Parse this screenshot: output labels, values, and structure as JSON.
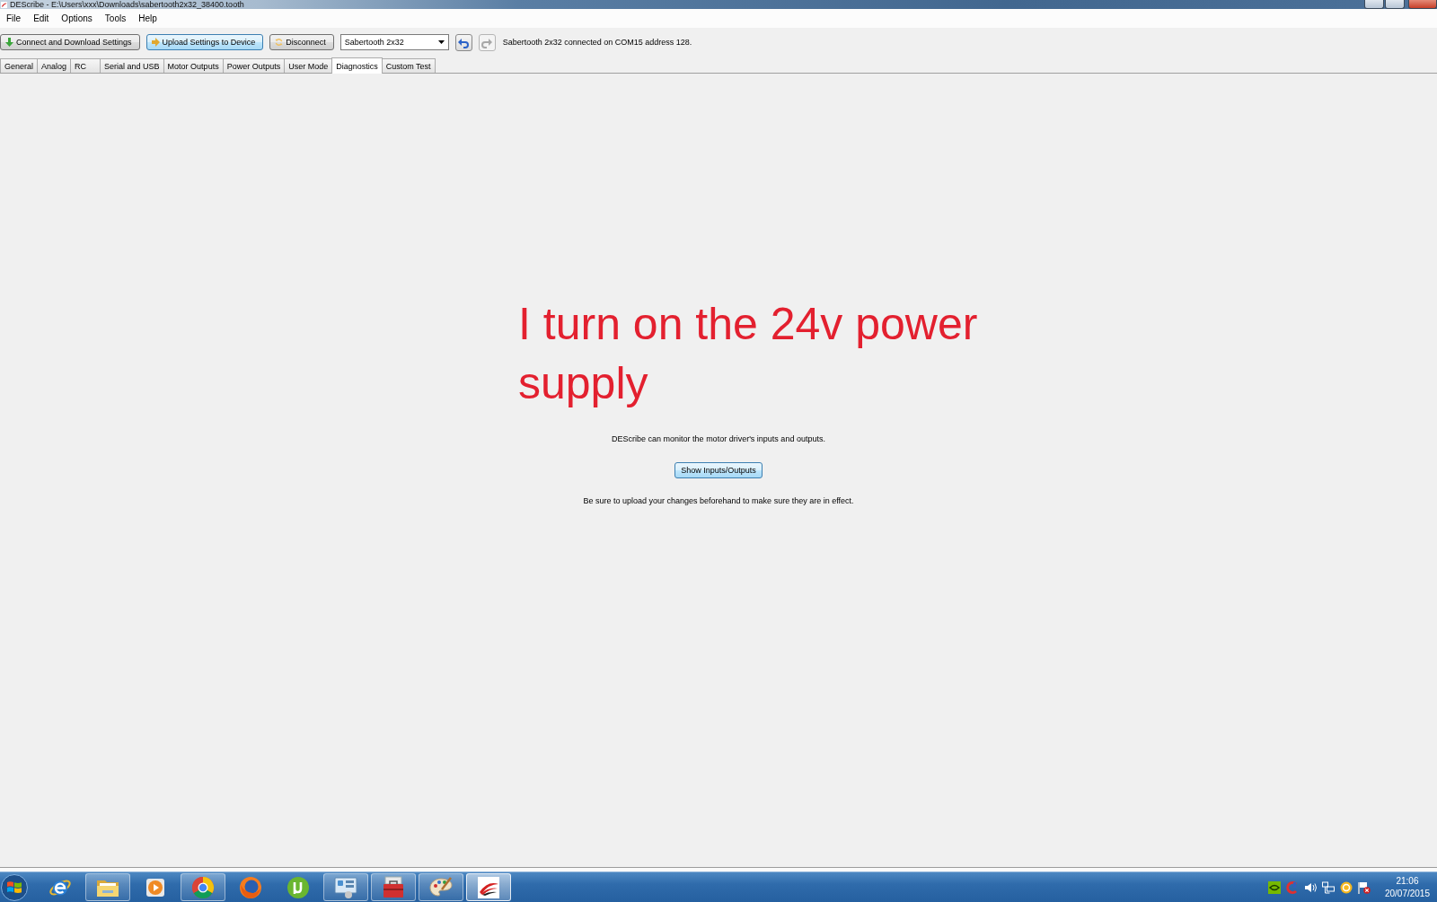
{
  "window": {
    "title": "DEScribe - E:\\Users\\xxx\\Downloads\\sabertooth2x32_38400.tooth"
  },
  "menu": [
    "File",
    "Edit",
    "Options",
    "Tools",
    "Help"
  ],
  "toolbar": {
    "buttons": [
      {
        "kind": "download",
        "label": "Connect and Download Settings",
        "focused": false
      },
      {
        "kind": "upload",
        "label": "Upload Settings to Device",
        "focused": true
      },
      {
        "kind": "disconnect",
        "label": "Disconnect",
        "focused": false
      }
    ],
    "device_select": {
      "value": "Sabertooth 2x32"
    },
    "history": [
      {
        "kind": "undo",
        "disabled": false
      },
      {
        "kind": "redo",
        "disabled": true
      }
    ],
    "status": "Sabertooth 2x32 connected on COM15 address 128."
  },
  "tabs": [
    {
      "label": "General",
      "selected": false
    },
    {
      "label": "Analog",
      "selected": false
    },
    {
      "label": "RC",
      "selected": false
    },
    {
      "label": "Serial and USB",
      "selected": false
    },
    {
      "label": "Motor Outputs",
      "selected": false
    },
    {
      "label": "Power Outputs",
      "selected": false
    },
    {
      "label": "User Mode",
      "selected": false
    },
    {
      "label": "Diagnostics",
      "selected": true
    },
    {
      "label": "Custom Test",
      "selected": false
    }
  ],
  "annotation": "I turn on the 24v power supply",
  "diagnostics": {
    "intro": "DEScribe can monitor the motor driver's inputs and outputs.",
    "button": "Show Inputs/Outputs",
    "note": "Be sure to upload your changes beforehand to make sure they are in effect."
  },
  "taskbar": {
    "apps": [
      {
        "kind": "e",
        "running": false,
        "active": false
      },
      {
        "kind": "folder",
        "running": true,
        "active": false
      },
      {
        "kind": "play",
        "running": false,
        "active": false
      },
      {
        "kind": "ring",
        "running": true,
        "active": false
      },
      {
        "kind": "globe",
        "running": false,
        "active": false
      },
      {
        "kind": "mu",
        "running": false,
        "active": false
      },
      {
        "kind": "panel",
        "running": true,
        "active": false
      },
      {
        "kind": "toolbox",
        "running": true,
        "active": false
      },
      {
        "kind": "palette",
        "running": true,
        "active": false
      },
      {
        "kind": "swoosh",
        "running": true,
        "active": true
      }
    ],
    "clock": {
      "time": "21:06",
      "date": "20/07/2015"
    }
  }
}
